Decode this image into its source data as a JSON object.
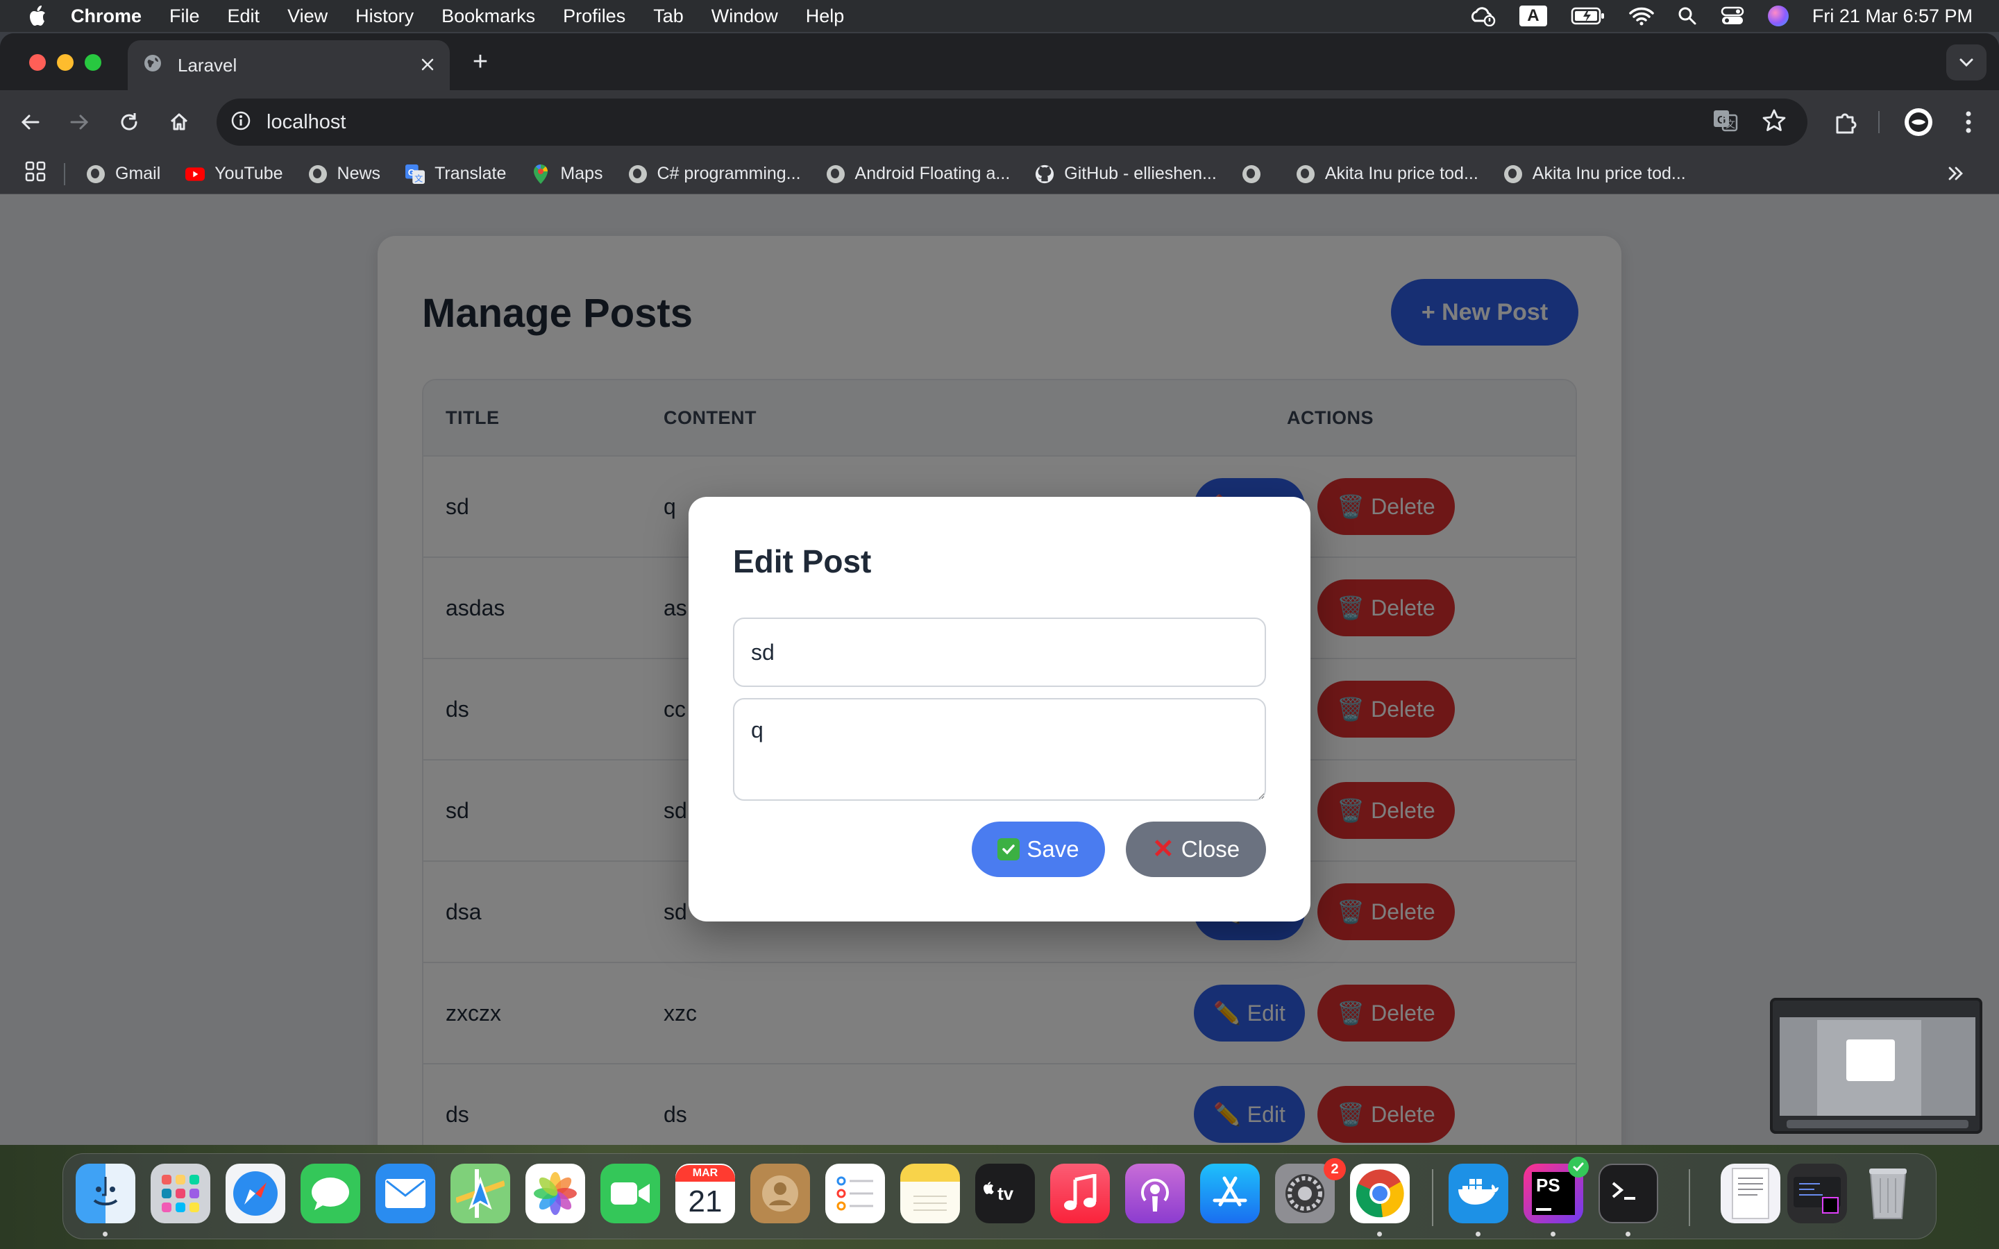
{
  "menubar": {
    "app_name": "Chrome",
    "items": [
      "File",
      "Edit",
      "View",
      "History",
      "Bookmarks",
      "Profiles",
      "Tab",
      "Window",
      "Help"
    ],
    "keyboard_input": "A",
    "clock": "Fri 21 Mar  6:57 PM"
  },
  "browser": {
    "tab_title": "Laravel",
    "url": "localhost",
    "bookmarks": [
      {
        "label": "Gmail",
        "icon": "globe-icon"
      },
      {
        "label": "YouTube",
        "icon": "youtube-icon"
      },
      {
        "label": "News",
        "icon": "globe-icon"
      },
      {
        "label": "Translate",
        "icon": "translate-icon"
      },
      {
        "label": "Maps",
        "icon": "maps-pin-icon"
      },
      {
        "label": "C# programming...",
        "icon": "globe-icon"
      },
      {
        "label": "Android Floating a...",
        "icon": "globe-icon"
      },
      {
        "label": "GitHub - ellieshen...",
        "icon": "github-icon"
      },
      {
        "label": "",
        "icon": "globe-icon"
      },
      {
        "label": "Akita Inu price tod...",
        "icon": "globe-icon"
      },
      {
        "label": "Akita Inu price tod...",
        "icon": "globe-icon"
      }
    ]
  },
  "page": {
    "title": "Manage Posts",
    "new_post_label": "+ New Post",
    "table": {
      "headers": {
        "title": "TITLE",
        "content": "CONTENT",
        "actions": "ACTIONS"
      },
      "edit_label": "✏️ Edit",
      "delete_label": "🗑️ Delete",
      "rows": [
        {
          "title": "sd",
          "content": "q"
        },
        {
          "title": "asdas",
          "content": "as"
        },
        {
          "title": "ds",
          "content": "cc"
        },
        {
          "title": "sd",
          "content": "sd"
        },
        {
          "title": "dsa",
          "content": "sd"
        },
        {
          "title": "zxczx",
          "content": "xzc"
        },
        {
          "title": "ds",
          "content": "ds"
        }
      ]
    }
  },
  "modal": {
    "title": "Edit Post",
    "title_value": "sd",
    "content_value": "q",
    "save_label": "Save",
    "close_label": "Close"
  },
  "dock": {
    "calendar_month": "MAR",
    "calendar_day": "21",
    "settings_badge": "2",
    "apps": [
      "Finder",
      "Launchpad",
      "Safari",
      "Messages",
      "Mail",
      "Maps",
      "Photos",
      "FaceTime",
      "Calendar",
      "Contacts",
      "Reminders",
      "Notes",
      "TV",
      "Music",
      "Podcasts",
      "App Store",
      "System Settings",
      "Chrome",
      "Docker",
      "PhpStorm",
      "Terminal"
    ]
  },
  "colors": {
    "accent_blue": "#2f5fe6",
    "danger_red": "#dc2f2f",
    "save_blue": "#4a7cf0",
    "close_gray": "#6b7280"
  }
}
